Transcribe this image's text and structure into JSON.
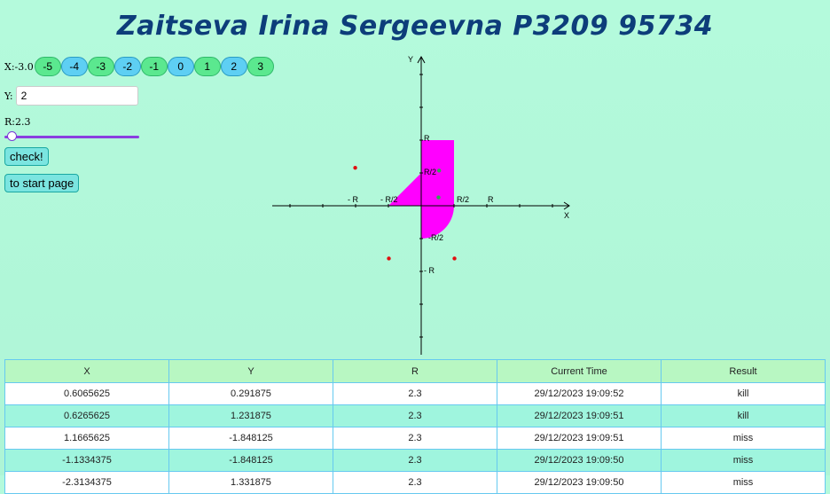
{
  "title": "Zaitseva Irina Sergeevna P3209 95734",
  "x_control": {
    "label": "X:-3.0",
    "buttons": [
      {
        "label": "-5",
        "color": "green"
      },
      {
        "label": "-4",
        "color": "blue"
      },
      {
        "label": "-3",
        "color": "green"
      },
      {
        "label": "-2",
        "color": "blue"
      },
      {
        "label": "-1",
        "color": "green"
      },
      {
        "label": "0",
        "color": "blue"
      },
      {
        "label": "1",
        "color": "green"
      },
      {
        "label": "2",
        "color": "blue"
      },
      {
        "label": "3",
        "color": "green"
      }
    ]
  },
  "y_control": {
    "label": "Y:",
    "value": "2"
  },
  "r_control": {
    "label": "R:2.3",
    "value": 2.3,
    "min": 1,
    "max": 4
  },
  "check_button": "check!",
  "start_page_button": "to start page",
  "graph": {
    "x_axis": "X",
    "y_axis": "Y",
    "tick_labels": {
      "minus_r": "- R",
      "minus_r_half": "- R/2",
      "r_half": "R/2",
      "r": "R",
      "y_r": "R",
      "y_r_half": "R/2",
      "y_minus_r_half": "-R/2",
      "y_minus_r": "- R"
    },
    "area_color": "#ff00ff",
    "points": [
      {
        "x": 0.6065625,
        "y": 0.291875,
        "hit": true
      },
      {
        "x": 0.6265625,
        "y": 1.231875,
        "hit": true
      },
      {
        "x": 1.1665625,
        "y": -1.848125,
        "hit": false
      },
      {
        "x": -1.1334375,
        "y": -1.848125,
        "hit": false
      },
      {
        "x": -2.3134375,
        "y": 1.331875,
        "hit": false
      }
    ]
  },
  "table": {
    "headers": [
      "X",
      "Y",
      "R",
      "Current Time",
      "Result"
    ],
    "rows": [
      {
        "x": "0.6065625",
        "y": "0.291875",
        "r": "2.3",
        "time": "29/12/2023 19:09:52",
        "result": "kill"
      },
      {
        "x": "0.6265625",
        "y": "1.231875",
        "r": "2.3",
        "time": "29/12/2023 19:09:51",
        "result": "kill"
      },
      {
        "x": "1.1665625",
        "y": "-1.848125",
        "r": "2.3",
        "time": "29/12/2023 19:09:51",
        "result": "miss"
      },
      {
        "x": "-1.1334375",
        "y": "-1.848125",
        "r": "2.3",
        "time": "29/12/2023 19:09:50",
        "result": "miss"
      },
      {
        "x": "-2.3134375",
        "y": "1.331875",
        "r": "2.3",
        "time": "29/12/2023 19:09:50",
        "result": "miss"
      }
    ]
  }
}
